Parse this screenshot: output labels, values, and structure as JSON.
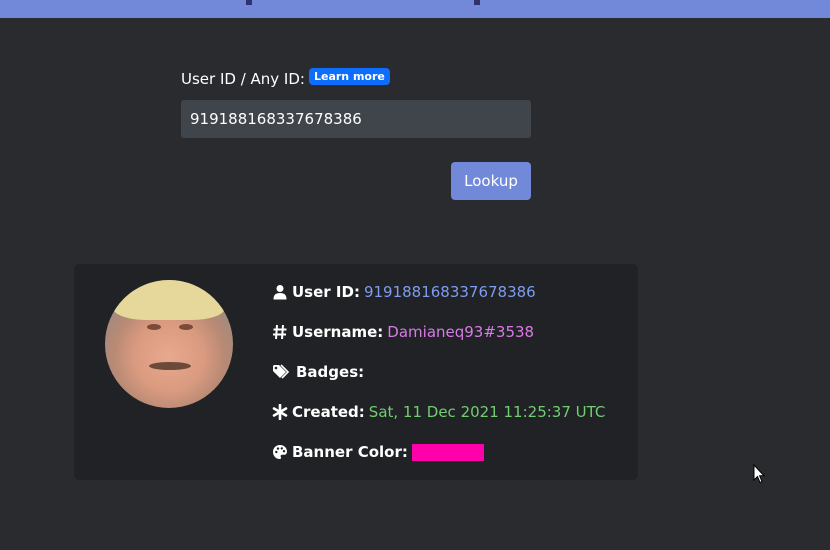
{
  "form": {
    "label": "User ID / Any ID:",
    "learn_more": "Learn more",
    "input_value": "919188168337678386",
    "lookup_button": "Lookup"
  },
  "result": {
    "user_id_label": "User ID",
    "user_id_value": "919188168337678386",
    "username_label": "Username",
    "username_value": "Damianeq93#3538",
    "badges_label": "Badges",
    "created_label": "Created",
    "created_value": "Sat, 11 Dec 2021 11:25:37 UTC",
    "banner_color_label": "Banner Color",
    "banner_color": "#ff00aa"
  },
  "icons": {
    "user_id": "user-icon",
    "username": "hash-icon",
    "badges": "tags-icon",
    "created": "asterisk-icon",
    "banner_color": "palette-icon"
  },
  "colors": {
    "background": "#292b2f",
    "card": "#202225",
    "accent": "#7289da",
    "input": "#40444b",
    "learn_more": "#0d6efd",
    "user_id_value": "#7e9cf0",
    "username_value": "#d97ae6",
    "created_value": "#6fcf6f"
  }
}
